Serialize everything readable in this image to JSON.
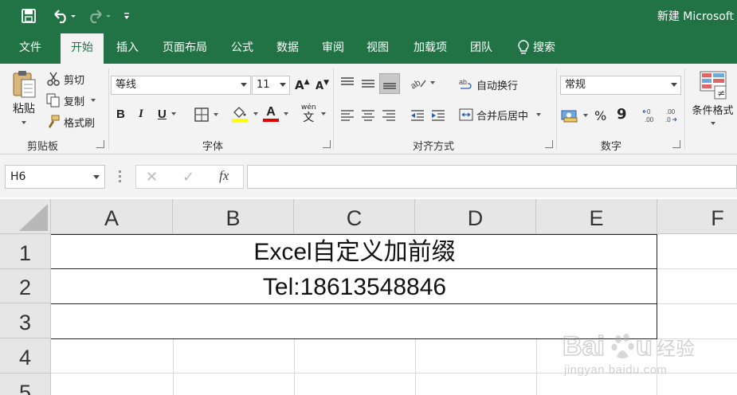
{
  "title_bar": {
    "title": "新建 Microsoft",
    "quick_access": [
      "save-icon",
      "undo-icon",
      "redo-icon",
      "customize-icon"
    ]
  },
  "tabs": [
    {
      "label": "文件",
      "active": false
    },
    {
      "label": "开始",
      "active": true
    },
    {
      "label": "插入",
      "active": false
    },
    {
      "label": "页面布局",
      "active": false
    },
    {
      "label": "公式",
      "active": false
    },
    {
      "label": "数据",
      "active": false
    },
    {
      "label": "审阅",
      "active": false
    },
    {
      "label": "视图",
      "active": false
    },
    {
      "label": "加载项",
      "active": false
    },
    {
      "label": "团队",
      "active": false
    }
  ],
  "tell_me": {
    "label": "搜索"
  },
  "ribbon": {
    "clipboard": {
      "group_label": "剪贴板",
      "paste": "粘贴",
      "cut": "剪切",
      "copy": "复制",
      "format_painter": "格式刷"
    },
    "font": {
      "group_label": "字体",
      "font_name": "等线",
      "font_size": "11",
      "bold": "B",
      "italic": "I",
      "underline": "U",
      "grow": "A",
      "shrink": "A",
      "font_color_letter": "A",
      "phonetic": "wén"
    },
    "alignment": {
      "group_label": "对齐方式",
      "wrap_text": "自动换行",
      "merge_center": "合并后居中"
    },
    "number": {
      "group_label": "数字",
      "format": "常规",
      "percent": "%",
      "comma": "9"
    },
    "styles": {
      "conditional": "条件格式"
    }
  },
  "formula_bar": {
    "name_box": "H6",
    "cancel": "✕",
    "enter": "✓",
    "fx": "fx",
    "formula": ""
  },
  "columns": [
    "A",
    "B",
    "C",
    "D",
    "E",
    "F"
  ],
  "rows": [
    "1",
    "2",
    "3",
    "4",
    "5"
  ],
  "cells": {
    "A1": "Excel自定义加前缀",
    "A2": "Tel:18613548846"
  },
  "colors": {
    "excel_green": "#217346",
    "ribbon_bg": "#f3f3f3",
    "header_bg": "#e6e6e6",
    "highlight_yellow": "#ffff00",
    "font_red": "#e00000"
  },
  "watermark": {
    "brand": "Baidu",
    "brand_cn": "经验",
    "url": "jingyan.baidu.com"
  }
}
